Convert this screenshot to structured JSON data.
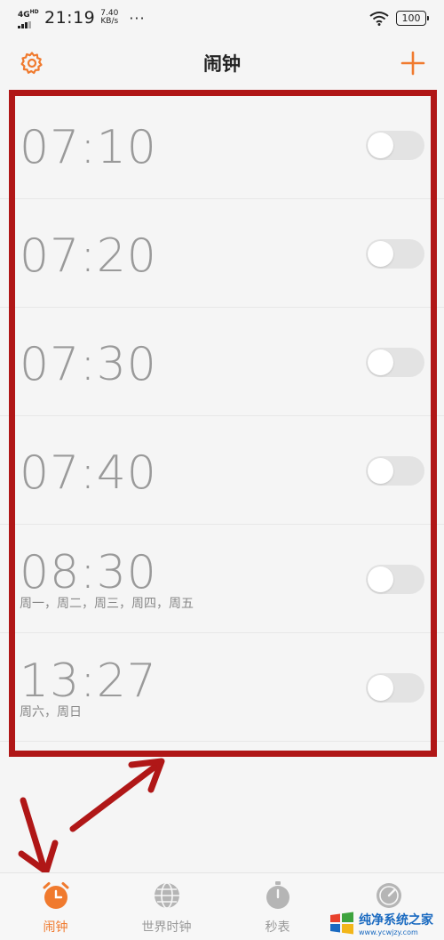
{
  "status_bar": {
    "network": "4G",
    "network_sub": "HD",
    "time": "21:19",
    "speed_value": "7.40",
    "speed_unit": "KB/s",
    "more": "···",
    "battery": "100"
  },
  "header": {
    "title": "闹钟",
    "settings_icon": "gear-icon",
    "add_icon": "plus-icon"
  },
  "alarms": [
    {
      "time": "07:10",
      "days": "",
      "enabled": false
    },
    {
      "time": "07:20",
      "days": "",
      "enabled": false
    },
    {
      "time": "07:30",
      "days": "",
      "enabled": false
    },
    {
      "time": "07:40",
      "days": "",
      "enabled": false
    },
    {
      "time": "08:30",
      "days": "周一，周二，周三，周四，周五",
      "enabled": false
    },
    {
      "time": "13:27",
      "days": "周六，周日",
      "enabled": false
    }
  ],
  "tabs": [
    {
      "label": "闹钟",
      "icon": "alarm-clock-icon",
      "active": true
    },
    {
      "label": "世界时钟",
      "icon": "globe-icon",
      "active": false
    },
    {
      "label": "秒表",
      "icon": "stopwatch-icon",
      "active": false
    },
    {
      "label": "",
      "icon": "timer-icon",
      "active": false
    }
  ],
  "watermark": {
    "name": "纯净系统之家",
    "url": "www.ycwjzy.com"
  },
  "colors": {
    "accent": "#f07a2e",
    "annotation": "#b01717",
    "toggle_off": "#e3e3e3",
    "alarm_text": "#9a9a9a"
  }
}
